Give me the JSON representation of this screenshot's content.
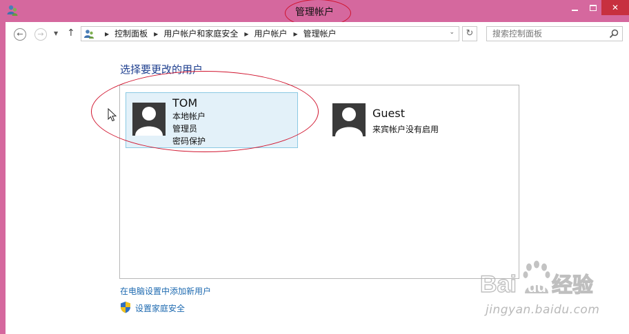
{
  "window": {
    "title": "管理帐户"
  },
  "navigation": {
    "breadcrumbs": [
      "控制面板",
      "用户帐户和家庭安全",
      "用户帐户",
      "管理帐户"
    ],
    "search_placeholder": "搜索控制面板"
  },
  "main": {
    "heading": "选择要更改的用户",
    "accounts": [
      {
        "name": "TOM",
        "details": [
          "本地帐户",
          "管理员",
          "密码保护"
        ]
      },
      {
        "name": "Guest",
        "details": [
          "来宾帐户没有启用"
        ]
      }
    ],
    "links": {
      "add_user": "在电脑设置中添加新用户",
      "family_safety": "设置家庭安全"
    }
  },
  "watermark": {
    "logo_text": "Baidu经验",
    "url": "jingyan.baidu.com"
  },
  "colors": {
    "window_frame": "#d5689e",
    "close_button": "#c7303f",
    "heading": "#1e3f8f",
    "link": "#1e6ab0",
    "selected_tile": "#e3f1f9",
    "selected_border": "#8ac9e3",
    "annotation_ring": "#d0122c"
  }
}
